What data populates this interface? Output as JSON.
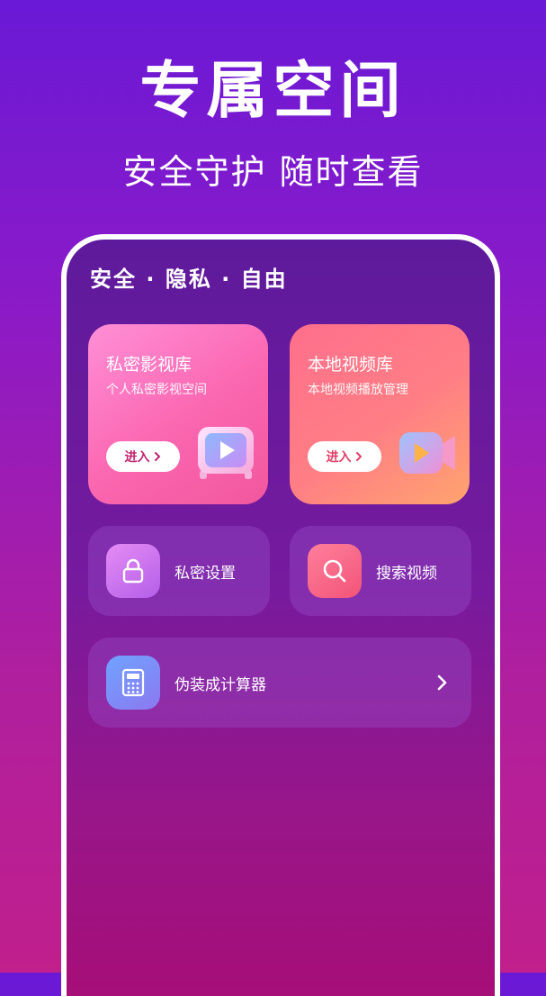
{
  "hero": {
    "title": "专属空间",
    "subtitle": "安全守护 随时查看"
  },
  "tagline": "安全 · 隐私 · 自由",
  "cards": [
    {
      "title": "私密影视库",
      "subtitle": "个人私密影视空间",
      "button": "进入",
      "icon": "tv-play-icon"
    },
    {
      "title": "本地视频库",
      "subtitle": "本地视频播放管理",
      "button": "进入",
      "icon": "video-camera-icon"
    }
  ],
  "tiles": [
    {
      "label": "私密设置",
      "icon": "lock-icon"
    },
    {
      "label": "搜索视频",
      "icon": "search-icon"
    },
    {
      "label": "伪装成计算器",
      "icon": "calculator-icon"
    }
  ],
  "colors": {
    "background_top": "#6a19d6",
    "background_bottom": "#c01f8c",
    "card1": "#fb66b0",
    "card2": "#ff7f85"
  }
}
